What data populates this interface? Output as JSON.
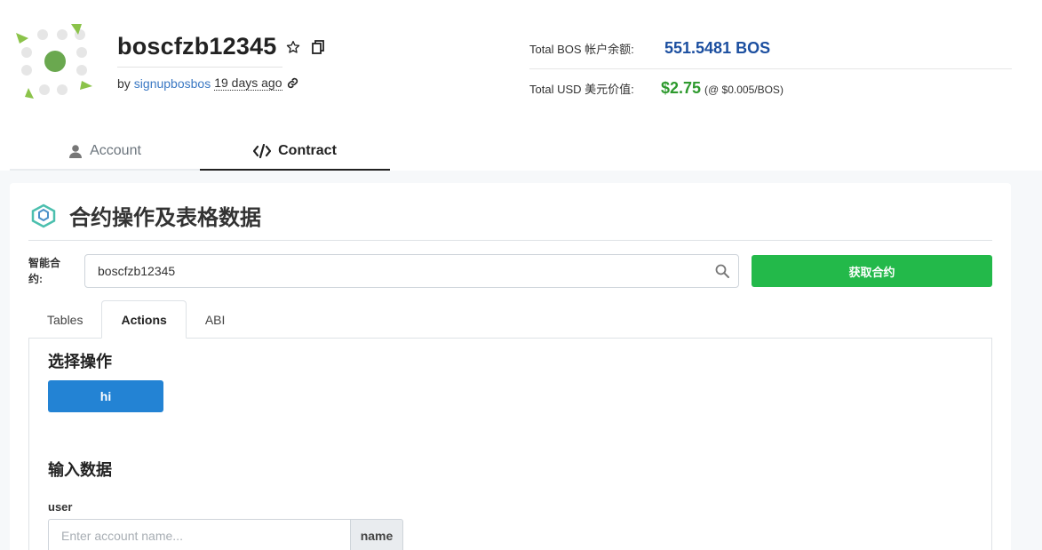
{
  "account": {
    "name": "boscfzb12345",
    "by_prefix": "by",
    "creator": "signupbosbos",
    "created_ago": "19 days ago"
  },
  "balances": {
    "bos_label": "Total BOS 帐户余额:",
    "bos_value": "551.5481 BOS",
    "usd_label": "Total USD 美元价值:",
    "usd_value": "$2.75",
    "usd_rate": "(@ $0.005/BOS)"
  },
  "nav": {
    "tabs": [
      {
        "label": "Account",
        "icon": "user-icon",
        "active": false
      },
      {
        "label": "Contract",
        "icon": "code-icon",
        "active": true
      }
    ]
  },
  "contract": {
    "section_title": "合约操作及表格数据",
    "smart_contract_label": "智能合约:",
    "contract_input_value": "boscfzb12345",
    "fetch_button": "获取合约",
    "tabs": [
      {
        "label": "Tables",
        "active": false
      },
      {
        "label": "Actions",
        "active": true
      },
      {
        "label": "ABI",
        "active": false
      }
    ],
    "select_action_heading": "选择操作",
    "action_button": "hi",
    "input_data_heading": "输入数据",
    "field_label": "user",
    "field_placeholder": "Enter account name...",
    "field_type": "name"
  },
  "colors": {
    "bos_value": "#1c4fa0",
    "usd_value": "#2e9a2e",
    "fetch_button": "#23b94a",
    "action_button": "#2383d4",
    "link": "#3a78c3",
    "logo_green": "#8bc34a"
  }
}
